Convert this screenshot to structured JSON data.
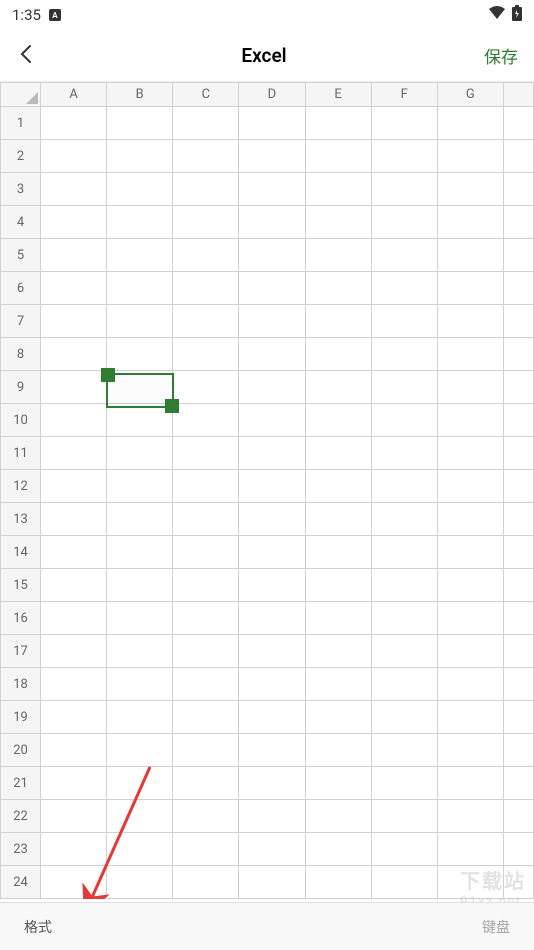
{
  "status": {
    "time": "1:35",
    "indicator": "A"
  },
  "header": {
    "title": "Excel",
    "save_label": "保存"
  },
  "grid": {
    "columns": [
      "A",
      "B",
      "C",
      "D",
      "E",
      "F",
      "G"
    ],
    "rows": [
      "1",
      "2",
      "3",
      "4",
      "5",
      "6",
      "7",
      "8",
      "9",
      "10",
      "11",
      "12",
      "13",
      "14",
      "15",
      "16",
      "17",
      "18",
      "19",
      "20",
      "21",
      "22",
      "23",
      "24"
    ],
    "selection": {
      "start": "B9",
      "end": "B9"
    }
  },
  "bottom": {
    "format_label": "格式",
    "keyboard_label": "键盘"
  },
  "watermark": {
    "line1": "下载站",
    "line2": "91xz.net"
  }
}
